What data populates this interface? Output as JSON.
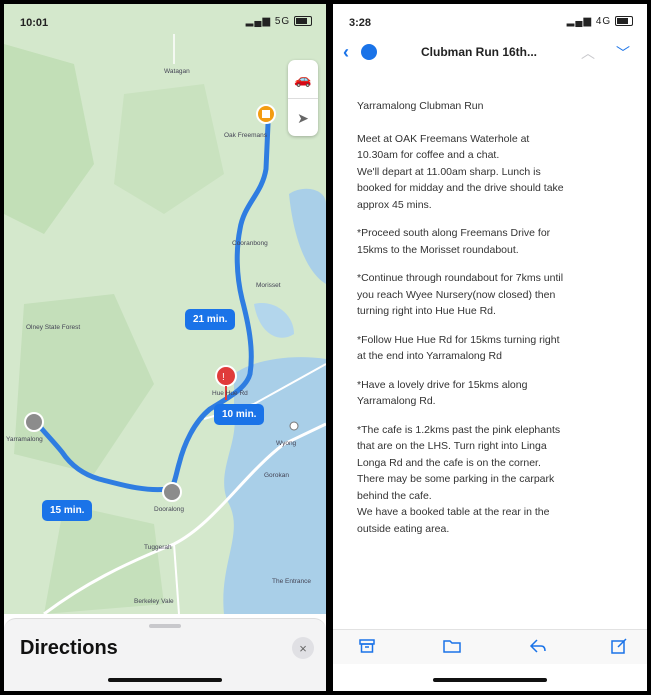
{
  "left_phone": {
    "status": {
      "time": "10:01",
      "network": "5G"
    },
    "map": {
      "places": [
        {
          "id": "oak",
          "name": "Oak Freemans"
        },
        {
          "id": "cooranbong",
          "name": "Cooranbong"
        },
        {
          "id": "morisset",
          "name": "Morisset"
        },
        {
          "id": "huehue",
          "name": "Hue Hue Rd"
        },
        {
          "id": "dooralong",
          "name": "Dooralong"
        },
        {
          "id": "yarramalong",
          "name": "Yarramalong"
        },
        {
          "id": "wyong",
          "name": "Wyong"
        },
        {
          "id": "tuggerah",
          "name": "Tuggerah"
        },
        {
          "id": "berkeley",
          "name": "Berkeley Vale"
        },
        {
          "id": "entrance",
          "name": "The Entrance"
        },
        {
          "id": "gorokan",
          "name": "Gorokan"
        },
        {
          "id": "olneyforest",
          "name": "Olney State Forest"
        },
        {
          "id": "watagan",
          "name": "Watagan"
        }
      ],
      "badges": {
        "b21": "21 min.",
        "b10": "10 min.",
        "b15": "15 min."
      }
    },
    "sheet": {
      "title": "Directions",
      "close": "×"
    }
  },
  "right_phone": {
    "status": {
      "time": "3:28",
      "network": "4G"
    },
    "nav": {
      "subject": "Clubman Run 16th...",
      "unread_count": ""
    },
    "email": {
      "heading": "Yarramalong Clubman Run",
      "p1": [
        "Meet at OAK Freemans Waterhole at",
        "10.30am for coffee and a chat.",
        "We'll depart at 11.00am sharp. Lunch is",
        "booked for midday and the drive should take",
        "approx 45 mins."
      ],
      "p2": [
        "*Proceed south along Freemans Drive for",
        "15kms to the Morisset roundabout."
      ],
      "p3": [
        "*Continue through roundabout for 7kms until",
        "you reach Wyee Nursery(now closed) then",
        "turning right into Hue Hue Rd."
      ],
      "p4": [
        "*Follow Hue Hue Rd for 15kms turning right",
        "at the end into Yarramalong Rd"
      ],
      "p5": [
        "*Have a lovely drive for 15kms along",
        "Yarramalong Rd."
      ],
      "p6": [
        "*The cafe is 1.2kms past the pink elephants",
        "that are on the LHS. Turn right into Linga",
        "Longa Rd and the cafe is on the corner.",
        "There may be some parking in the carpark",
        "behind the cafe.",
        "We have a booked table at the rear in the",
        "outside eating area."
      ]
    }
  },
  "colors": {
    "accent": "#1a73e8",
    "route": "#2f7de1",
    "map_green": "#cfe5c6",
    "water": "#a9cfe8",
    "pin_red": "#e03b3b",
    "fuel_orange": "#f39c12"
  }
}
